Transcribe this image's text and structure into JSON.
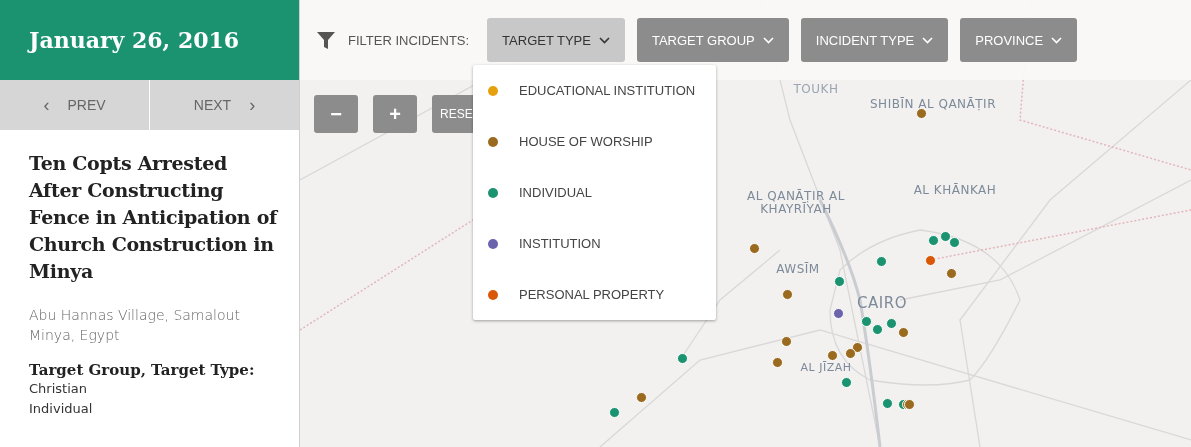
{
  "sidebar": {
    "date": "January 26, 2016",
    "prev": {
      "icon": "‹",
      "label": "PREV"
    },
    "next": {
      "label": "NEXT",
      "icon": "›"
    },
    "title": "Ten Copts Arrested After Constructing Fence in Anticipation of Church Construction in Minya",
    "location": [
      "Abu Hannas Village, Samalout",
      "Minya, Egypt"
    ],
    "details_heading": "Target Group, Target Type:",
    "details": [
      "Christian",
      "Individual"
    ]
  },
  "filter_bar": {
    "label": "FILTER INCIDENTS:",
    "filters": [
      {
        "label": "TARGET TYPE",
        "selected": true
      },
      {
        "label": "TARGET GROUP",
        "selected": false
      },
      {
        "label": "INCIDENT TYPE",
        "selected": false
      },
      {
        "label": "PROVINCE",
        "selected": false
      }
    ]
  },
  "dropdown": [
    {
      "label": "EDUCATIONAL INSTITUTION",
      "color": "#e5a00d"
    },
    {
      "label": "HOUSE OF WORSHIP",
      "color": "#9a6a1f"
    },
    {
      "label": "INDIVIDUAL",
      "color": "#1b9370"
    },
    {
      "label": "INSTITUTION",
      "color": "#6c63ad"
    },
    {
      "label": "PERSONAL PROPERTY",
      "color": "#d95808"
    }
  ],
  "zoom_controls": [
    "−",
    "+",
    "RESE"
  ],
  "map": {
    "places": [
      "TOUKH",
      "SHIBĪN AL QANĀṬIR",
      "AL QANĀṬIR AL KHAYRĪYAH",
      "AL KHĀNKAH",
      "AWSĪM",
      "CAIRO",
      "AL JĪZAH"
    ],
    "markers": [
      {
        "color": "#9a6a1f"
      },
      {
        "color": "#9a6a1f"
      },
      {
        "color": "#1b9370"
      },
      {
        "color": "#1b9370"
      },
      {
        "color": "#1b9370"
      },
      {
        "color": "#d95808"
      },
      {
        "color": "#9a6a1f"
      },
      {
        "color": "#1b9370"
      },
      {
        "color": "#1b9370"
      },
      {
        "color": "#9a6a1f"
      },
      {
        "color": "#6c63ad"
      },
      {
        "color": "#1b9370"
      },
      {
        "color": "#1b9370"
      },
      {
        "color": "#1b9370"
      },
      {
        "color": "#9a6a1f"
      },
      {
        "color": "#9a6a1f"
      },
      {
        "color": "#9a6a1f"
      },
      {
        "color": "#9a6a1f"
      },
      {
        "color": "#9a6a1f"
      },
      {
        "color": "#9a6a1f"
      },
      {
        "color": "#1b9370"
      },
      {
        "color": "#1b9370"
      },
      {
        "color": "#9a6a1f"
      },
      {
        "color": "#1b9370"
      },
      {
        "color": "#1b9370"
      },
      {
        "color": "#1b9370"
      },
      {
        "color": "#9a6a1f"
      },
      {
        "color": "#9a6a1f"
      }
    ]
  }
}
